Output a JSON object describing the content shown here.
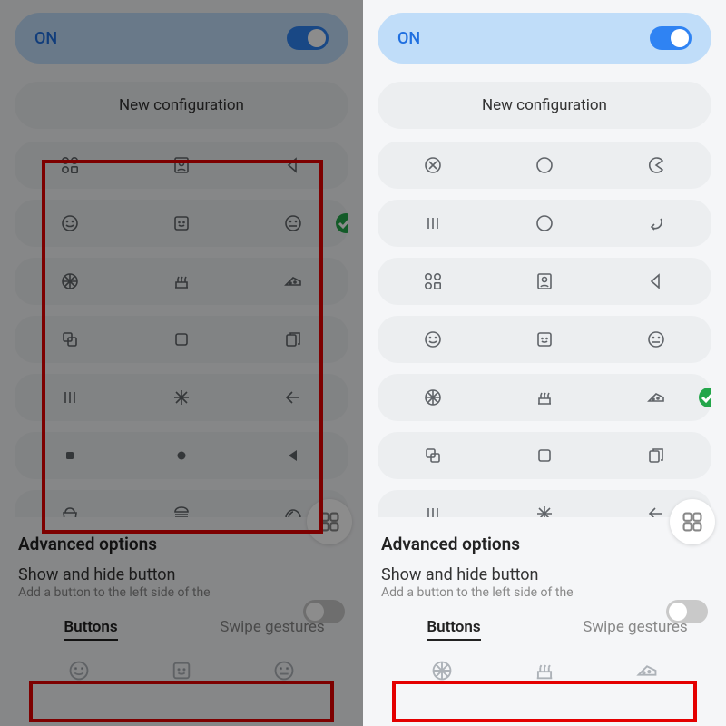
{
  "toggle_label": "ON",
  "new_config_label": "New configuration",
  "advanced_header": "Advanced options",
  "showhide_title": "Show and hide button",
  "showhide_sub": "Add a button to the left side of the",
  "tab_buttons": "Buttons",
  "tab_swipe": "Swipe gestures",
  "panes": [
    {
      "id": "left",
      "dimmed": true,
      "selected_row_index": 1,
      "icon_grid_redbox": true,
      "preview_redbox": true,
      "rows": [
        [
          "apps-icon",
          "portrait-icon",
          "back-arrow-icon"
        ],
        [
          "face-smile-icon",
          "smiley-box-icon",
          "face-neutral-icon"
        ],
        [
          "pizza-icon",
          "cake-icon",
          "cheese-icon"
        ],
        [
          "stack-icon",
          "square-icon",
          "copy-icon"
        ],
        [
          "bars-icon",
          "asterisk-icon",
          "arrow-left-icon"
        ],
        [
          "square-solid-icon",
          "dot-solid-icon",
          "triangle-left-icon"
        ],
        [
          "popcorn-icon",
          "burger-icon",
          "taco-icon"
        ]
      ],
      "preview": [
        "face-smile-icon",
        "smiley-box-icon",
        "face-neutral-icon"
      ]
    },
    {
      "id": "right",
      "dimmed": false,
      "selected_row_index": 4,
      "icon_grid_redbox": false,
      "preview_redbox": true,
      "rows": [
        [
          "circle-x-icon",
          "circle-o-icon",
          "circle-pac-icon"
        ],
        [
          "bars-icon",
          "circle-o-icon",
          "undo-icon"
        ],
        [
          "apps-icon",
          "portrait-icon",
          "back-arrow-icon"
        ],
        [
          "face-smile-icon",
          "smiley-box-icon",
          "face-neutral-icon"
        ],
        [
          "pizza-icon",
          "cake-icon",
          "cheese-icon"
        ],
        [
          "stack-icon",
          "square-icon",
          "copy-icon"
        ],
        [
          "bars-icon",
          "asterisk-icon",
          "arrow-left-icon"
        ]
      ],
      "preview": [
        "pizza-icon",
        "cake-icon",
        "cheese-icon"
      ]
    }
  ]
}
